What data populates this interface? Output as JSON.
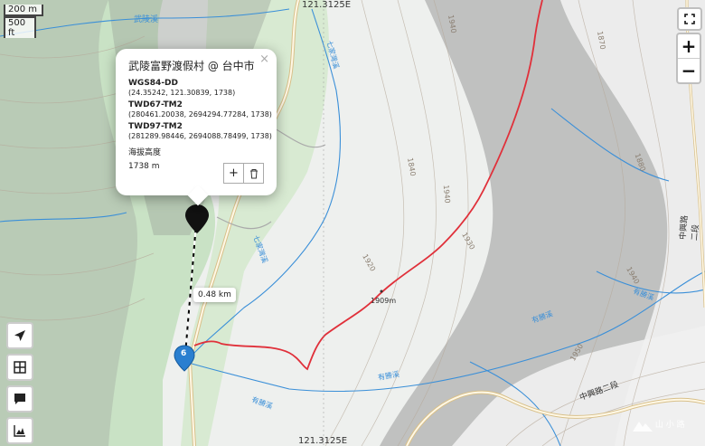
{
  "map": {
    "scale_metric": "200 m",
    "scale_imperial": "500 ft",
    "longitude_top": "121.3125E",
    "longitude_bottom": "121.3125E",
    "peak_label": "1909m",
    "contour_labels": [
      "1940",
      "1940",
      "1870",
      "1880",
      "1930",
      "1840",
      "1920",
      "1940"
    ],
    "place_labels": [
      "武陵溪",
      "七家灣溪",
      "七家灣溪",
      "有勝溪",
      "有勝溪",
      "有勝溪",
      "有勝溪",
      "中興路二段",
      "中興路二段",
      "1950"
    ],
    "colors": {
      "route": "#e0303a",
      "water": "#3a8fd8",
      "vegetation": "#cfe7cc",
      "road": "#d8c08a"
    }
  },
  "popup": {
    "title": "武陵富野渡假村 @ 台中市",
    "wgs_label": "WGS84-DD",
    "wgs_value": "(24.35242, 121.30839, 1738)",
    "twd67_label": "TWD67-TM2",
    "twd67_value": "(280461.20038, 2694294.77284, 1738)",
    "twd97_label": "TWD97-TM2",
    "twd97_value": "(281289.98446, 2694088.78499, 1738)",
    "elev_label": "海拔高度",
    "elev_value": "1738 m",
    "close_glyph": "×",
    "add_icon": "plus-icon",
    "delete_icon": "trash-icon"
  },
  "distance_label": "0.48 km",
  "marker_number": "6",
  "controls": {
    "fullscreen_icon": "fullscreen-icon",
    "zoom_in": "+",
    "zoom_out": "−",
    "side": [
      "locate-icon",
      "layers-icon",
      "comment-icon",
      "elevation-chart-icon"
    ]
  },
  "watermark": "山 小 路"
}
